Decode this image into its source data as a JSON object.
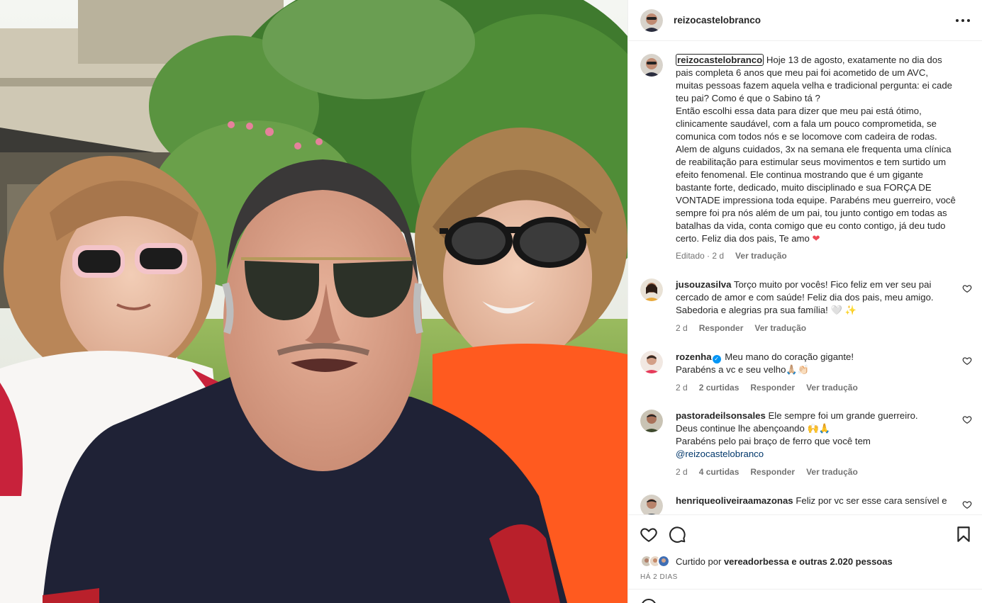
{
  "post": {
    "author": "reizocastelobranco",
    "caption": "Hoje 13 de agosto, exatamente no dia dos pais completa 6 anos que meu pai foi acometido de um AVC, muitas pessoas fazem aquela velha e tradicional pergunta: ei cade teu pai? Como é que o Sabino tá ?\nEntão escolhi essa data para dizer que meu pai está ótimo, clinicamente saudável, com a fala um pouco comprometida, se comunica com todos nós e se locomove com cadeira de rodas. Alem de alguns cuidados, 3x na semana ele frequenta uma clínica de reabilitação para estimular seus movimentos e tem surtido um efeito fenomenal. Ele continua mostrando que é um gigante bastante forte, dedicado, muito disciplinado e sua FORÇA DE VONTADE impressiona toda equipe. Parabéns meu guerreiro, você sempre foi pra nós além de um pai, tou junto contigo em todas as batalhas da vida, conta comigo que eu conto contigo, já deu tudo certo. Feliz dia dos pais, Te amo",
    "caption_emoji": "❤",
    "edited": "Editado · 2 d",
    "translate": "Ver tradução"
  },
  "comments": [
    {
      "user": "jusouzasilva",
      "text": "Torço muito por vocês! Fico feliz em ver seu pai cercado de amor e com saúde! Feliz dia dos pais, meu amigo. Sabedoria e alegrias pra sua família! 🤍 ✨",
      "time": "2 d",
      "reply": "Responder",
      "translate": "Ver tradução"
    },
    {
      "user": "rozenha",
      "verified": "✓",
      "text": "Meu mano do coração gigante!\nParabéns a vc e seu velho🙏🏼👏🏻",
      "time": "2 d",
      "likes": "2 curtidas",
      "reply": "Responder",
      "translate": "Ver tradução"
    },
    {
      "user": "pastoradeilsonsales",
      "text": "Ele sempre foi um grande guerreiro.\nDeus continue lhe abençoando 🙌🙏\nParabéns pelo pai braço de ferro que você tem",
      "mention": "@reizocastelobranco",
      "time": "2 d",
      "likes": "4 curtidas",
      "reply": "Responder",
      "translate": "Ver tradução"
    },
    {
      "user": "henriqueoliveiraamazonas",
      "text": "Feliz por vc ser esse cara sensível e"
    }
  ],
  "likes": {
    "prefix": "Curtido por",
    "user": "vereadorbessa",
    "rest": "e outras 2.020 pessoas"
  },
  "date": "HÁ 2 DIAS",
  "icons": {
    "like": "heart-icon",
    "comment": "comment-icon",
    "save": "bookmark-icon",
    "more": "more-icon"
  },
  "colors": {
    "text": "#262626",
    "muted": "#737373",
    "link": "#00376b",
    "verified": "#0095f6",
    "heart": "#ed4956"
  }
}
